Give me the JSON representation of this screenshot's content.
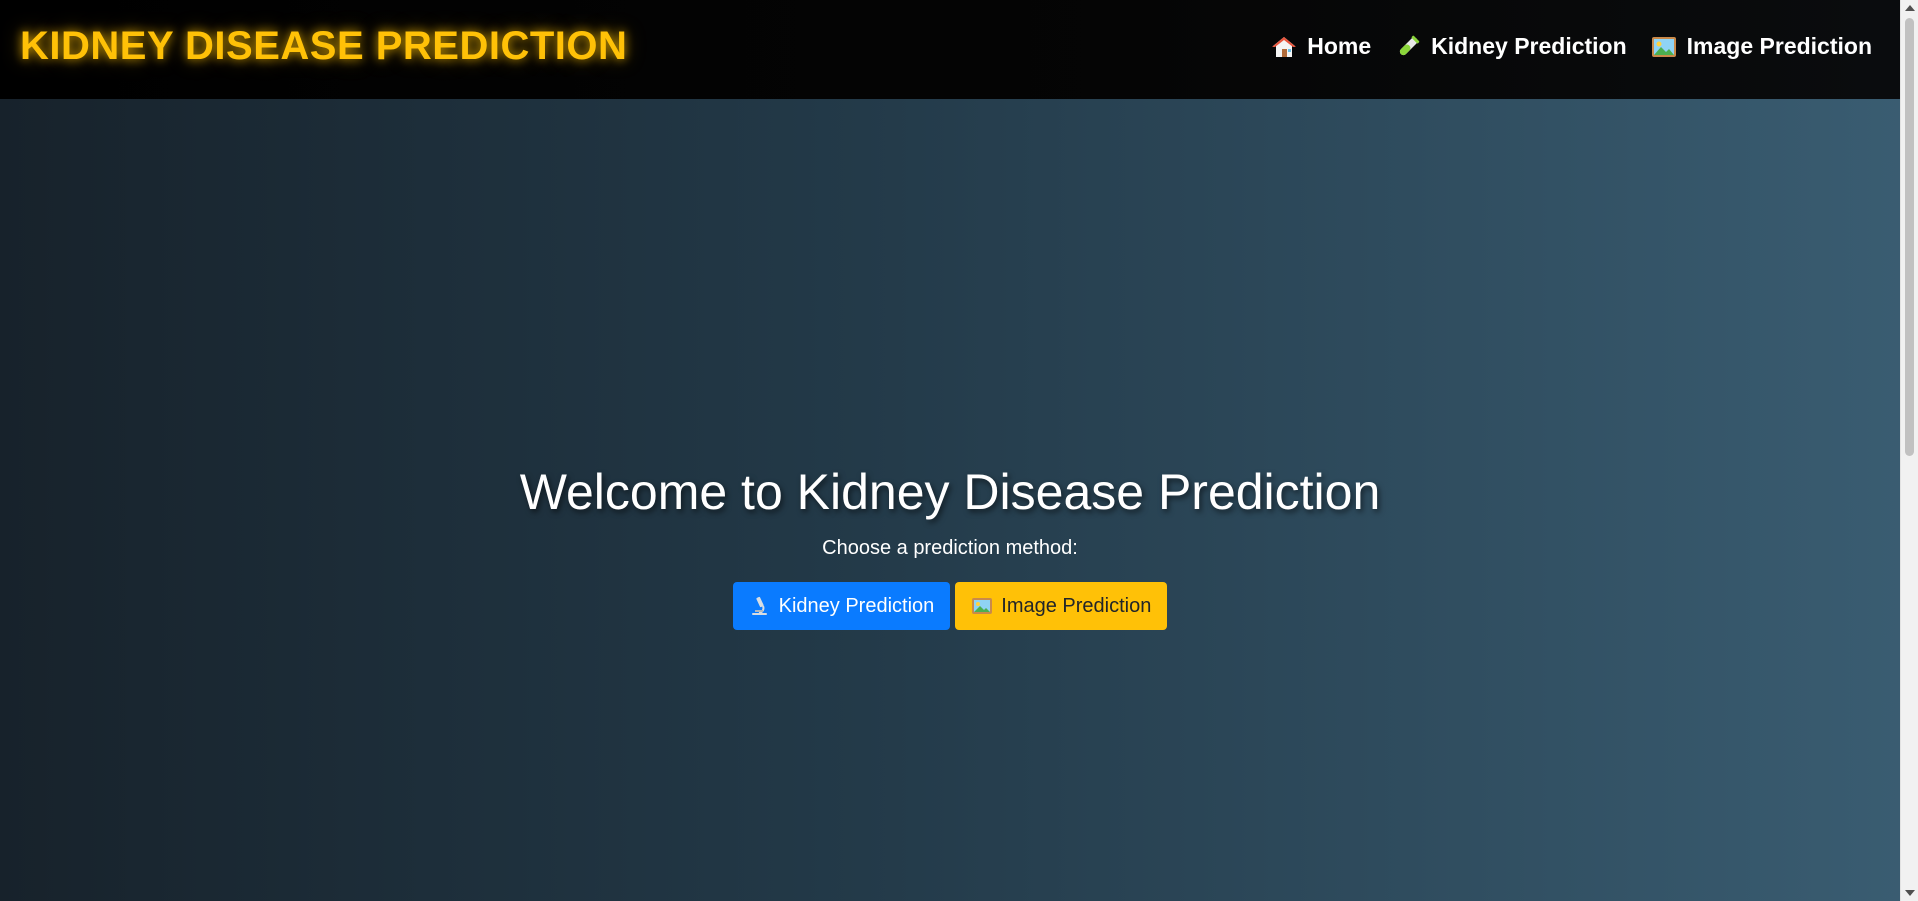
{
  "header": {
    "brand": "KIDNEY DISEASE PREDICTION",
    "nav": [
      {
        "label": "Home",
        "icon": "house-icon"
      },
      {
        "label": "Kidney Prediction",
        "icon": "test-tube-icon"
      },
      {
        "label": "Image Prediction",
        "icon": "picture-icon"
      }
    ]
  },
  "hero": {
    "title": "Welcome to Kidney Disease Prediction",
    "subtitle": "Choose a prediction method:",
    "buttons": [
      {
        "label": "Kidney Prediction",
        "icon": "microscope-icon",
        "color": "#0a7bff"
      },
      {
        "label": "Image Prediction",
        "icon": "picture-icon",
        "color": "#ffc107"
      }
    ]
  },
  "colors": {
    "brand": "#ffc107",
    "primary": "#0a7bff",
    "warning": "#ffc107"
  }
}
